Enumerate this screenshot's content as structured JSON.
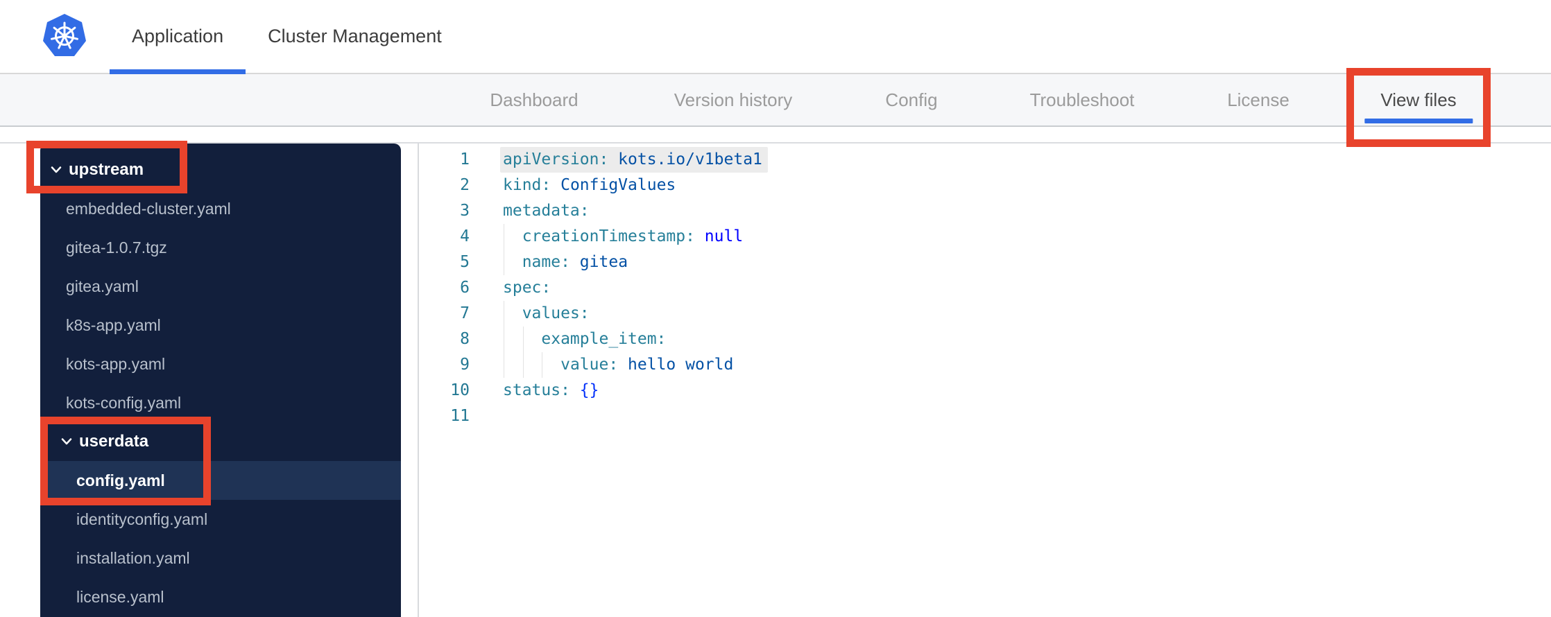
{
  "colors": {
    "accent_blue": "#326de6",
    "logo_blue": "#326ce5",
    "annotation_red": "#e8432c",
    "sidebar_bg": "#121f3c",
    "sidebar_selected_bg": "#1f3355",
    "sidebar_file_text": "#b8c0cc",
    "nav_tab_inactive": "#9b9b9b",
    "nav_tab_active": "#4a4a4a",
    "editor_border": "#d8dadd",
    "line_highlight_bg": "#ececec",
    "code_key": "#267f99",
    "code_value": "#0451a5",
    "code_keyword": "#0000ff",
    "code_brace": "#0431fa",
    "line_number": "#237893"
  },
  "top_nav": {
    "logo_icon": "kubernetes-helm-logo",
    "tabs": [
      {
        "label": "Application",
        "active": true
      },
      {
        "label": "Cluster Management",
        "active": false
      }
    ]
  },
  "secondary_nav": {
    "tabs": [
      {
        "label": "Dashboard",
        "active": false
      },
      {
        "label": "Version history",
        "active": false
      },
      {
        "label": "Config",
        "active": false
      },
      {
        "label": "Troubleshoot",
        "active": false
      },
      {
        "label": "License",
        "active": false
      },
      {
        "label": "View files",
        "active": true
      }
    ]
  },
  "file_tree": {
    "items": [
      {
        "label": "upstream",
        "type": "folder",
        "level": 0,
        "expanded": true,
        "selected": false
      },
      {
        "label": "embedded-cluster.yaml",
        "type": "file",
        "level": 1,
        "selected": false
      },
      {
        "label": "gitea-1.0.7.tgz",
        "type": "file",
        "level": 1,
        "selected": false
      },
      {
        "label": "gitea.yaml",
        "type": "file",
        "level": 1,
        "selected": false
      },
      {
        "label": "k8s-app.yaml",
        "type": "file",
        "level": 1,
        "selected": false
      },
      {
        "label": "kots-app.yaml",
        "type": "file",
        "level": 1,
        "selected": false
      },
      {
        "label": "kots-config.yaml",
        "type": "file",
        "level": 1,
        "selected": false
      },
      {
        "label": "userdata",
        "type": "folder",
        "level": 1,
        "expanded": true,
        "selected": false
      },
      {
        "label": "config.yaml",
        "type": "file",
        "level": 2,
        "selected": true
      },
      {
        "label": "identityconfig.yaml",
        "type": "file",
        "level": 2,
        "selected": false
      },
      {
        "label": "installation.yaml",
        "type": "file",
        "level": 2,
        "selected": false
      },
      {
        "label": "license.yaml",
        "type": "file",
        "level": 2,
        "selected": false
      }
    ]
  },
  "editor": {
    "language": "yaml",
    "lines": [
      {
        "num": "1",
        "guides": 0,
        "highlight": true,
        "segments": [
          {
            "t": "apiVersion:",
            "c": "key"
          },
          {
            "t": " kots.io/v1beta1",
            "c": "val"
          }
        ]
      },
      {
        "num": "2",
        "guides": 0,
        "highlight": false,
        "segments": [
          {
            "t": "kind:",
            "c": "key"
          },
          {
            "t": " ConfigValues",
            "c": "val"
          }
        ]
      },
      {
        "num": "3",
        "guides": 0,
        "highlight": false,
        "segments": [
          {
            "t": "metadata:",
            "c": "key"
          }
        ]
      },
      {
        "num": "4",
        "guides": 1,
        "highlight": false,
        "segments": [
          {
            "t": "  ",
            "c": "plain"
          },
          {
            "t": "creationTimestamp:",
            "c": "key"
          },
          {
            "t": " null",
            "c": "kw"
          }
        ]
      },
      {
        "num": "5",
        "guides": 1,
        "highlight": false,
        "segments": [
          {
            "t": "  ",
            "c": "plain"
          },
          {
            "t": "name:",
            "c": "key"
          },
          {
            "t": " gitea",
            "c": "val"
          }
        ]
      },
      {
        "num": "6",
        "guides": 0,
        "highlight": false,
        "segments": [
          {
            "t": "spec:",
            "c": "key"
          }
        ]
      },
      {
        "num": "7",
        "guides": 1,
        "highlight": false,
        "segments": [
          {
            "t": "  ",
            "c": "plain"
          },
          {
            "t": "values:",
            "c": "key"
          }
        ]
      },
      {
        "num": "8",
        "guides": 2,
        "highlight": false,
        "segments": [
          {
            "t": "    ",
            "c": "plain"
          },
          {
            "t": "example_item:",
            "c": "key"
          }
        ]
      },
      {
        "num": "9",
        "guides": 3,
        "highlight": false,
        "segments": [
          {
            "t": "      ",
            "c": "plain"
          },
          {
            "t": "value:",
            "c": "key"
          },
          {
            "t": " hello world",
            "c": "val"
          }
        ]
      },
      {
        "num": "10",
        "guides": 0,
        "highlight": false,
        "segments": [
          {
            "t": "status:",
            "c": "key"
          },
          {
            "t": " {}",
            "c": "brace"
          }
        ]
      },
      {
        "num": "11",
        "guides": 0,
        "highlight": false,
        "segments": []
      }
    ]
  },
  "annotations": {
    "boxes": [
      {
        "target": "upstream-folder"
      },
      {
        "target": "userdata-and-config-yaml"
      },
      {
        "target": "view-files-tab"
      }
    ]
  }
}
